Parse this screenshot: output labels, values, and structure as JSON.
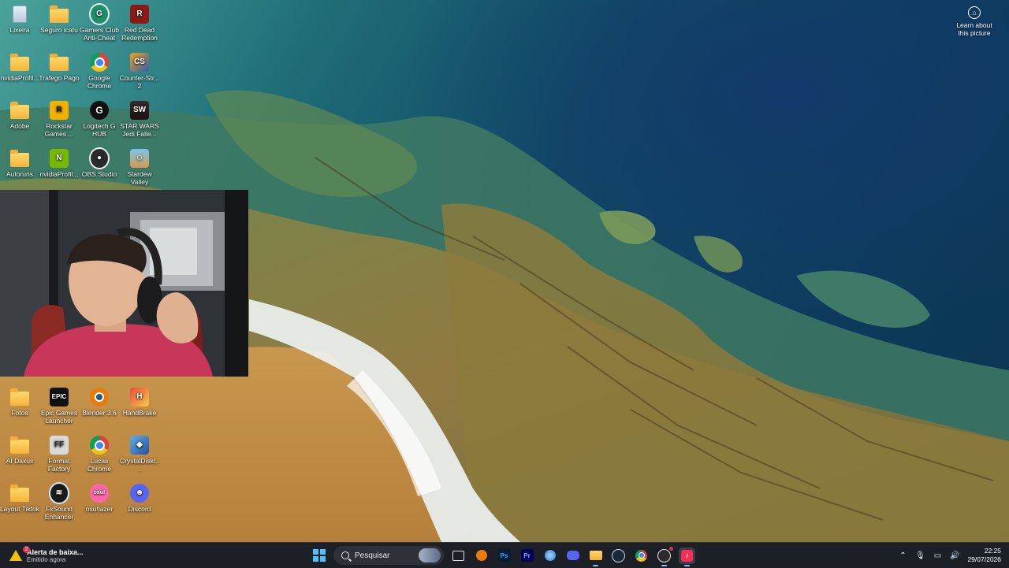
{
  "desktop": {
    "icons": [
      {
        "label": "Lixeira"
      },
      {
        "label": "Seguro icatu"
      },
      {
        "label": "Gamers Club Anti-Cheat"
      },
      {
        "label": "Red Dead Redemption"
      },
      {
        "label": "nvidiaProfil..."
      },
      {
        "label": "Trafego Pago"
      },
      {
        "label": "Google Chrome"
      },
      {
        "label": "Counter-Str... 2"
      },
      {
        "label": "Adobe"
      },
      {
        "label": "Rockstar Games ..."
      },
      {
        "label": "Logitech G HUB"
      },
      {
        "label": "STAR WARS Jedi Falle..."
      },
      {
        "label": "Autoruns"
      },
      {
        "label": "nvidiaProfil..."
      },
      {
        "label": "OBS Studio"
      },
      {
        "label": "Stardew Valley"
      },
      {
        "label": "Fotos"
      },
      {
        "label": "Epic Games Launcher"
      },
      {
        "label": "Blender 3.6"
      },
      {
        "label": "HandBrake"
      },
      {
        "label": "AI Daxus"
      },
      {
        "label": "Format Factory"
      },
      {
        "label": "Lucas Chrome"
      },
      {
        "label": "CrystalDiskI..."
      },
      {
        "label": "Layout Tiktok"
      },
      {
        "label": "FxSound Enhancer"
      },
      {
        "label": "osu!lazer"
      },
      {
        "label": "Discord"
      }
    ],
    "learn_picture": "Learn about this picture"
  },
  "taskbar": {
    "notification": {
      "title": "Alerta de baixa...",
      "subtitle": "Emitido agora",
      "badge": "2"
    },
    "search_placeholder": "Pesquisar",
    "apps": [
      "windows-start",
      "search",
      "widget",
      "task-view",
      "blender",
      "photoshop",
      "premiere",
      "app-blue",
      "discord",
      "file-explorer",
      "steam",
      "chrome",
      "obs",
      "tiktok"
    ],
    "clock": {
      "time": "22:25",
      "date": "29/07/2026"
    }
  },
  "colors": {
    "taskbar_bg": "#1c1f26",
    "win_blue": "#4cc2ff",
    "folder": "#f4b43a"
  }
}
